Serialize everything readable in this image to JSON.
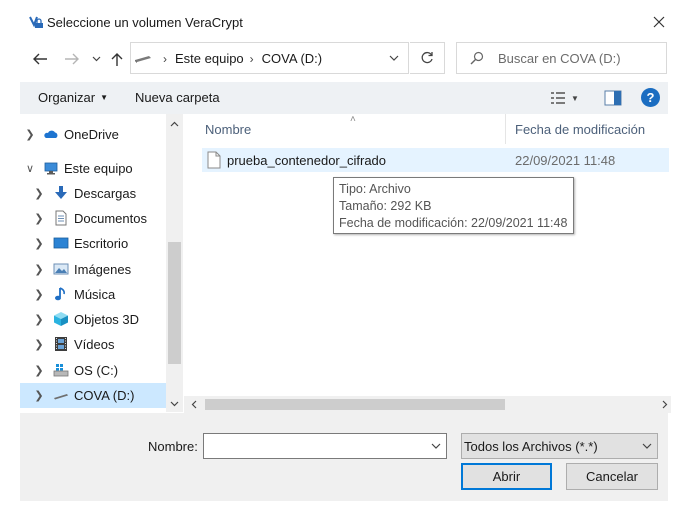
{
  "window": {
    "title": "Seleccione un volumen VeraCrypt"
  },
  "address": {
    "crumbs": [
      "Este equipo",
      "COVA (D:)"
    ]
  },
  "search": {
    "placeholder": "Buscar en COVA (D:)"
  },
  "toolbar": {
    "organize_label": "Organizar",
    "new_folder_label": "Nueva carpeta",
    "help_label": "?"
  },
  "nav": {
    "items": [
      {
        "label": "OneDrive",
        "icon": "onedrive-cloud-icon",
        "expanded": false,
        "level": 0
      },
      {
        "label": "Este equipo",
        "icon": "computer-icon",
        "expanded": true,
        "level": 0
      },
      {
        "label": "Descargas",
        "icon": "download-arrow-icon",
        "expanded": false,
        "level": 1
      },
      {
        "label": "Documentos",
        "icon": "document-icon",
        "expanded": false,
        "level": 1
      },
      {
        "label": "Escritorio",
        "icon": "desktop-icon",
        "expanded": false,
        "level": 1
      },
      {
        "label": "Imágenes",
        "icon": "pictures-icon",
        "expanded": false,
        "level": 1
      },
      {
        "label": "Música",
        "icon": "music-note-icon",
        "expanded": false,
        "level": 1
      },
      {
        "label": "Objetos 3D",
        "icon": "cube-icon",
        "expanded": false,
        "level": 1
      },
      {
        "label": "Vídeos",
        "icon": "film-icon",
        "expanded": false,
        "level": 1
      },
      {
        "label": "OS (C:)",
        "icon": "windows-drive-icon",
        "expanded": false,
        "level": 1
      },
      {
        "label": "COVA (D:)",
        "icon": "usb-drive-icon",
        "expanded": false,
        "level": 1,
        "selected": true
      }
    ]
  },
  "filelist": {
    "columns": [
      "Nombre",
      "Fecha de modificación"
    ],
    "files": [
      {
        "name": "prueba_contenedor_cifrado",
        "modified": "22/09/2021 11:48"
      }
    ]
  },
  "tooltip": {
    "lines": [
      "Tipo: Archivo",
      "Tamaño: 292 KB",
      "Fecha de modificación: 22/09/2021 11:48"
    ]
  },
  "footer": {
    "filename_label": "Nombre:",
    "filename_value": "",
    "filter_selected": "Todos los Archivos (*.*)",
    "open_label": "Abrir",
    "cancel_label": "Cancelar"
  },
  "colors": {
    "accent": "#0078d7",
    "selection": "#cce8ff",
    "hover_row": "#e5f3ff",
    "command_bar": "#eef1f4",
    "help_blue": "#1b6dc1"
  }
}
